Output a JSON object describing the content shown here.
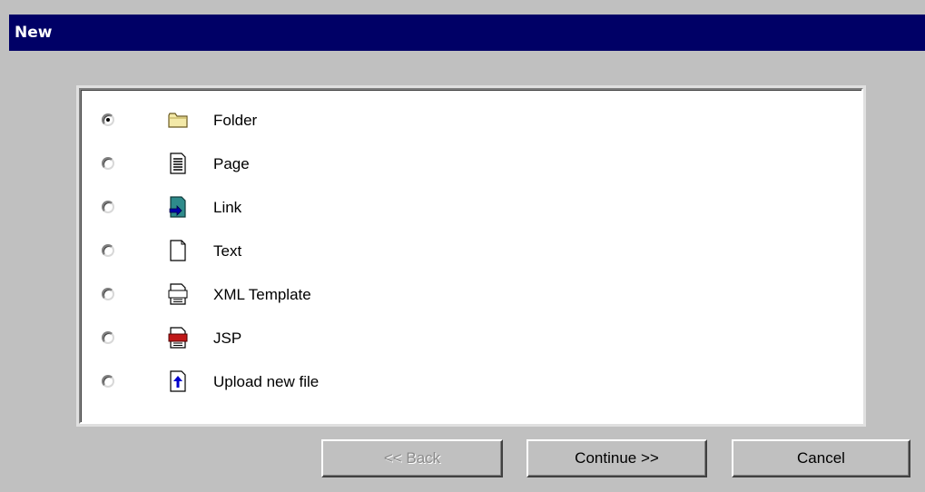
{
  "window": {
    "title": "New"
  },
  "options": [
    {
      "label": "Folder",
      "icon": "folder-icon",
      "selected": true
    },
    {
      "label": "Page",
      "icon": "page-icon",
      "selected": false
    },
    {
      "label": "Link",
      "icon": "link-icon",
      "selected": false
    },
    {
      "label": "Text",
      "icon": "text-icon",
      "selected": false
    },
    {
      "label": "XML Template",
      "icon": "xml-template-icon",
      "selected": false
    },
    {
      "label": "JSP",
      "icon": "jsp-icon",
      "selected": false
    },
    {
      "label": "Upload new file",
      "icon": "upload-icon",
      "selected": false
    }
  ],
  "buttons": {
    "back": "<< Back",
    "continue": "Continue >>",
    "cancel": "Cancel"
  },
  "colors": {
    "titlebar": "#000066",
    "dialog_bg": "#c0c0c0",
    "panel_bg": "#ffffff"
  }
}
